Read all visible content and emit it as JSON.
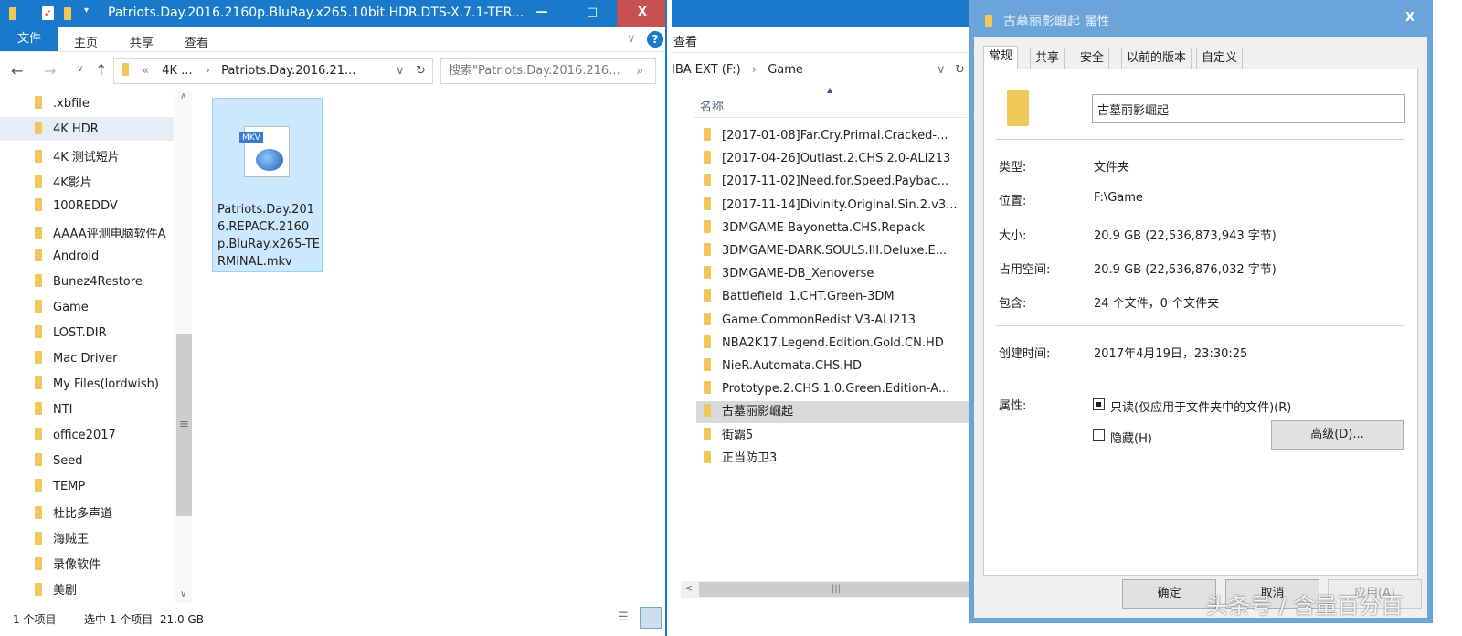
{
  "left_window": {
    "title": "Patriots.Day.2016.2160p.BluRay.x265.10bit.HDR.DTS-X.7.1-TER...",
    "controls": {
      "minimize": "—",
      "maximize": "□",
      "close": "X"
    },
    "ribbon_tabs": [
      "文件",
      "主页",
      "共享",
      "查看"
    ],
    "address": {
      "prefix": "«",
      "crumbs": [
        "4K ...",
        "Patriots.Day.2016.21..."
      ]
    },
    "search_placeholder": "搜索\"Patriots.Day.2016.216...",
    "nav_items": [
      ".xbfile",
      "4K HDR",
      "4K 测试短片",
      "4K影片",
      "100REDDV",
      "AAAA评测电脑软件A",
      "Android",
      "Bunez4Restore",
      "Game",
      "LOST.DIR",
      "Mac Driver",
      "My Files(lordwish)",
      "NTI",
      "office2017",
      "Seed",
      "TEMP",
      "杜比多声道",
      "海贼王",
      "录像软件",
      "美剧"
    ],
    "file": {
      "badge": "MKV",
      "name": "Patriots.Day.2016.REPACK.2160p.BluRay.x265-TERMiNAL.mkv"
    },
    "status": {
      "count": "1 个项目",
      "selected": "选中 1 个项目  21.0 GB"
    }
  },
  "middle_window": {
    "ribbon_tab": "查看",
    "address": {
      "crumbs": [
        "IBA EXT (F:)",
        "Game"
      ]
    },
    "column_header": "名称",
    "items": [
      "[2017-01-08]Far.Cry.Primal.Cracked-...",
      "[2017-04-26]Outlast.2.CHS.2.0-ALI213",
      "[2017-11-02]Need.for.Speed.Paybac...",
      "[2017-11-14]Divinity.Original.Sin.2.v3...",
      "3DMGAME-Bayonetta.CHS.Repack",
      "3DMGAME-DARK.SOULS.III.Deluxe.E...",
      "3DMGAME-DB_Xenoverse",
      "Battlefield_1.CHT.Green-3DM",
      "Game.CommonRedist.V3-ALI213",
      "NBA2K17.Legend.Edition.Gold.CN.HD",
      "NieR.Automata.CHS.HD",
      "Prototype.2.CHS.1.0.Green.Edition-A...",
      "古墓丽影崛起",
      "街霸5",
      "正当防卫3"
    ],
    "selected_index": 12
  },
  "dialog": {
    "title": "古墓丽影崛起 属性",
    "close": "X",
    "tabs": [
      "常规",
      "共享",
      "安全",
      "以前的版本",
      "自定义"
    ],
    "name_value": "古墓丽影崛起",
    "fields": [
      {
        "label": "类型:",
        "value": "文件夹"
      },
      {
        "label": "位置:",
        "value": "F:\\Game"
      },
      {
        "label": "大小:",
        "value": "20.9 GB (22,536,873,943 字节)"
      },
      {
        "label": "占用空间:",
        "value": "20.9 GB (22,536,876,032 字节)"
      },
      {
        "label": "包含:",
        "value": "24 个文件，0 个文件夹"
      },
      {
        "label": "创建时间:",
        "value": "2017年4月19日，23:30:25"
      }
    ],
    "attributes_label": "属性:",
    "readonly_label": "只读(仅应用于文件夹中的文件)(R)",
    "hidden_label": "隐藏(H)",
    "advanced_button": "高级(D)...",
    "ok": "确定",
    "cancel": "取消",
    "apply": "应用(A)"
  },
  "watermark": "头条号 / 含量百分百"
}
